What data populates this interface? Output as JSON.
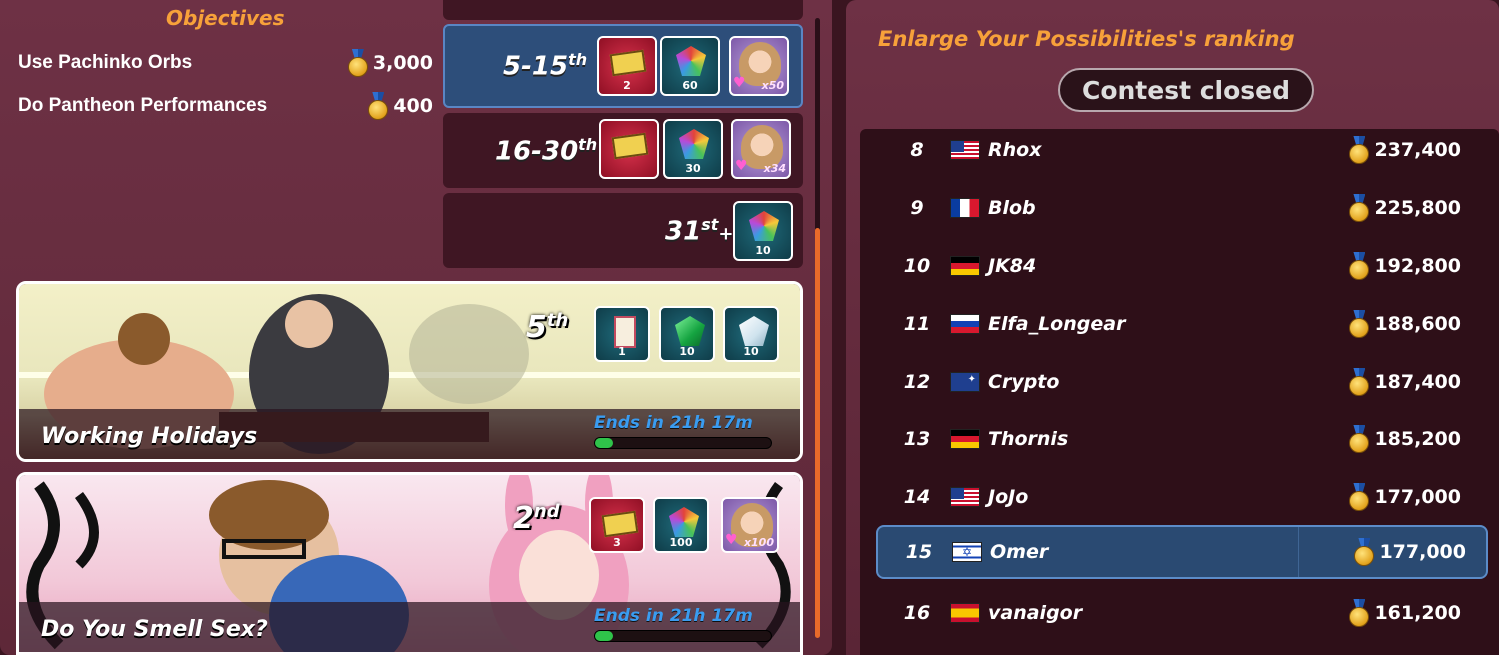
{
  "objectives": {
    "title": "Objectives",
    "items": [
      {
        "label": "Use Pachinko Orbs",
        "value": "3,000"
      },
      {
        "label": "Do Pantheon Performances",
        "value": "400"
      }
    ]
  },
  "tiers": [
    {
      "label": "5-15",
      "suffix": "th",
      "rewards": [
        {
          "type": "ticket",
          "qty": "2"
        },
        {
          "type": "gem-rainbow",
          "qty": "60"
        },
        {
          "type": "girl",
          "qty": "x50"
        }
      ]
    },
    {
      "label": "16-30",
      "suffix": "th",
      "rewards": [
        {
          "type": "ticket",
          "qty": ""
        },
        {
          "type": "gem-rainbow",
          "qty": "30"
        },
        {
          "type": "girl",
          "qty": "x34"
        }
      ]
    },
    {
      "label": "31",
      "suffix": "st",
      "extra": "+",
      "rewards": [
        {
          "type": "gem-rainbow",
          "qty": "10"
        }
      ]
    }
  ],
  "events": [
    {
      "title": "Working Holidays",
      "rank": "5",
      "rank_suffix": "th",
      "ends": "Ends in 21h 17m",
      "progress": 0.1,
      "rewards": [
        {
          "type": "card",
          "qty": "1"
        },
        {
          "type": "gem-green",
          "qty": "10"
        },
        {
          "type": "gem-white",
          "qty": "10"
        }
      ]
    },
    {
      "title": "Do You Smell Sex?",
      "rank": "2",
      "rank_suffix": "nd",
      "ends": "Ends in 21h 17m",
      "progress": 0.1,
      "rewards": [
        {
          "type": "ticket",
          "qty": "3"
        },
        {
          "type": "gem-rainbow",
          "qty": "100"
        },
        {
          "type": "girl",
          "qty": "x100"
        }
      ]
    }
  ],
  "ranking": {
    "title": "Enlarge Your Possibilities's ranking",
    "status": "Contest closed",
    "rows": [
      {
        "rank": "8",
        "flag": "us",
        "name": "Rhox",
        "score": "237,400"
      },
      {
        "rank": "9",
        "flag": "fr",
        "name": "Blob",
        "score": "225,800"
      },
      {
        "rank": "10",
        "flag": "de",
        "name": "JK84",
        "score": "192,800"
      },
      {
        "rank": "11",
        "flag": "ru",
        "name": "Elfa_Longear",
        "score": "188,600"
      },
      {
        "rank": "12",
        "flag": "au",
        "name": "Crypto",
        "score": "187,400"
      },
      {
        "rank": "13",
        "flag": "de",
        "name": "Thornis",
        "score": "185,200"
      },
      {
        "rank": "14",
        "flag": "us",
        "name": "JoJo",
        "score": "177,000"
      },
      {
        "rank": "15",
        "flag": "il",
        "name": "Omer",
        "score": "177,000",
        "active": true
      },
      {
        "rank": "16",
        "flag": "es",
        "name": "vanaigor",
        "score": "161,200"
      }
    ]
  }
}
